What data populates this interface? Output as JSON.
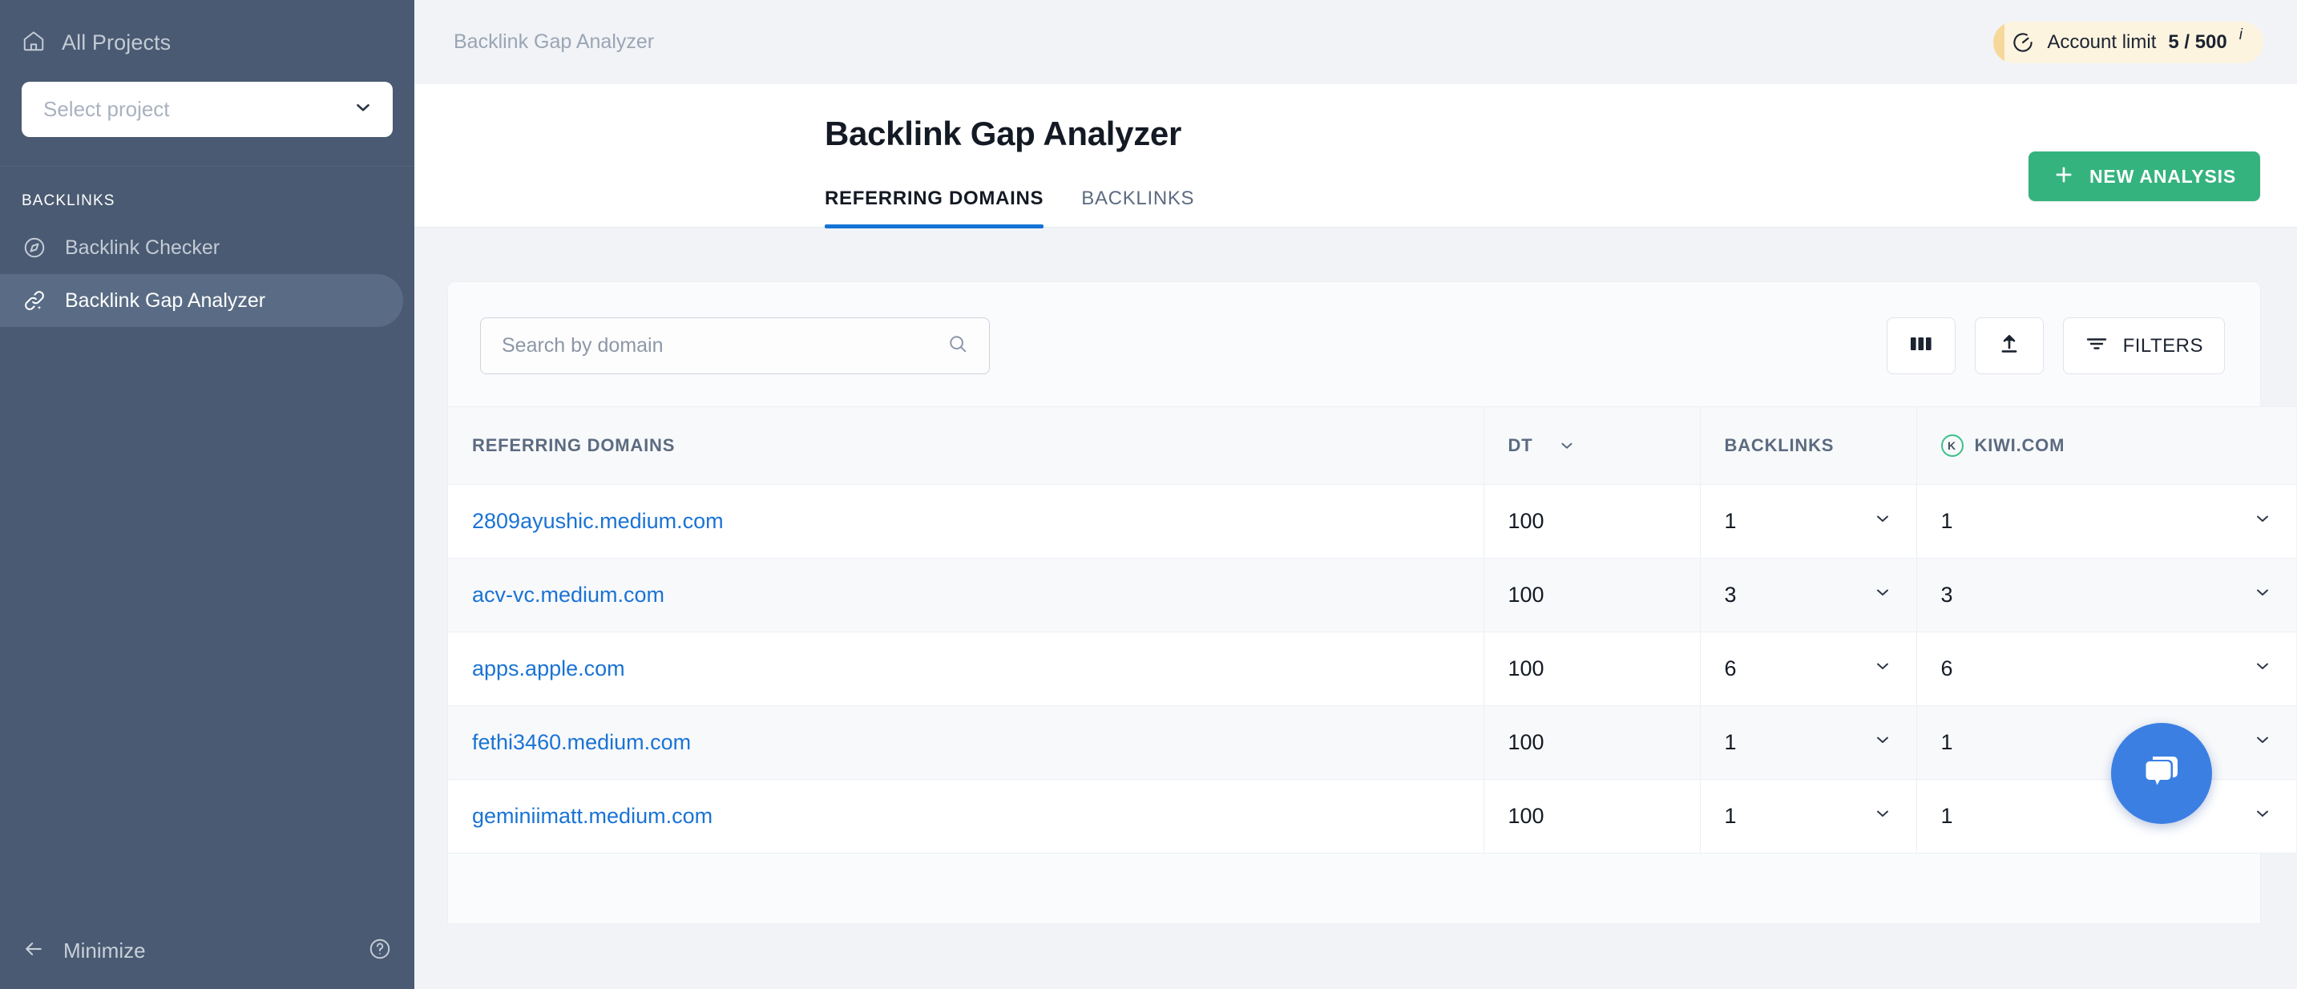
{
  "sidebar": {
    "all_projects_label": "All Projects",
    "project_select_placeholder": "Select project",
    "section_label": "BACKLINKS",
    "items": [
      {
        "label": "Backlink Checker",
        "icon": "compass-icon",
        "active": false
      },
      {
        "label": "Backlink Gap Analyzer",
        "icon": "link-sparkle-icon",
        "active": true
      }
    ],
    "minimize_label": "Minimize",
    "help_icon": "question-circle-icon"
  },
  "topbar": {
    "breadcrumb": "Backlink Gap Analyzer",
    "account_limit": {
      "icon": "gauge-icon",
      "label": "Account limit",
      "value": "5 / 500",
      "info_superscript": "i",
      "bg_color": "#fdf4e0",
      "accent_color": "#f6d89a"
    }
  },
  "page": {
    "title": "Backlink Gap Analyzer",
    "tabs": [
      {
        "label": "REFERRING DOMAINS",
        "active": true
      },
      {
        "label": "BACKLINKS",
        "active": false
      }
    ],
    "new_analysis_button": {
      "label": "NEW ANALYSIS",
      "icon": "plus-icon",
      "color": "#35b37e"
    },
    "accent_color": "#1573d6"
  },
  "toolbar": {
    "search_placeholder": "Search by domain",
    "search_value": "",
    "search_icon": "search-icon",
    "columns_button": {
      "label": "",
      "icon": "columns-icon"
    },
    "export_button": {
      "label": "",
      "icon": "upload-icon"
    },
    "filters_button": {
      "label": "FILTERS",
      "icon": "filter-icon"
    }
  },
  "table": {
    "columns": [
      {
        "key": "referring_domains",
        "label": "REFERRING DOMAINS",
        "sortable": false
      },
      {
        "key": "dt",
        "label": "DT",
        "sortable": true,
        "sort_icon": "chevron-down-icon"
      },
      {
        "key": "backlinks",
        "label": "BACKLINKS",
        "sortable": false
      },
      {
        "key": "kiwi",
        "label": "KIWI.COM",
        "favicon": "kiwi-favicon",
        "favicon_letter": "K",
        "favicon_color": "#3cc08a"
      }
    ],
    "rows": [
      {
        "referring_domains": "2809ayushic.medium.com",
        "dt": "100",
        "backlinks": "1",
        "kiwi": "1"
      },
      {
        "referring_domains": "acv-vc.medium.com",
        "dt": "100",
        "backlinks": "3",
        "kiwi": "3"
      },
      {
        "referring_domains": "apps.apple.com",
        "dt": "100",
        "backlinks": "6",
        "kiwi": "6"
      },
      {
        "referring_domains": "fethi3460.medium.com",
        "dt": "100",
        "backlinks": "1",
        "kiwi": "1"
      },
      {
        "referring_domains": "geminiimatt.medium.com",
        "dt": "100",
        "backlinks": "1",
        "kiwi": "1"
      }
    ]
  },
  "chat_widget": {
    "icon": "chat-bubbles-icon",
    "color": "#3b7fe3"
  }
}
